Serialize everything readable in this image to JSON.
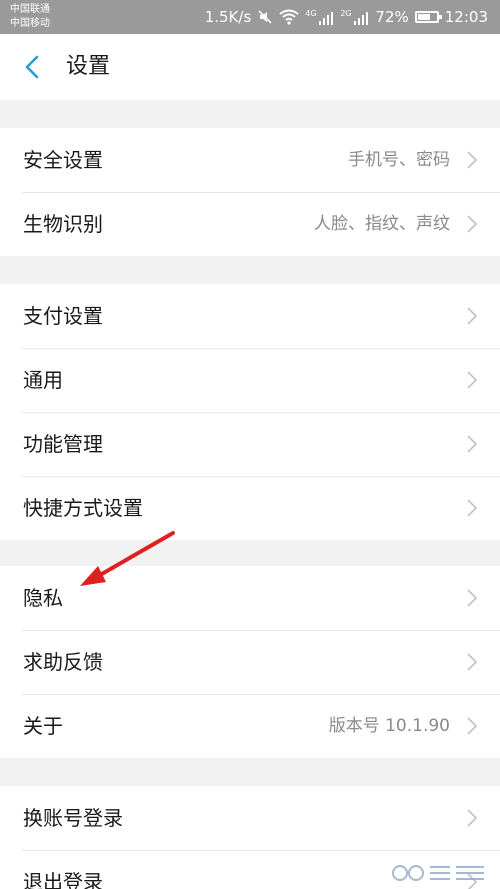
{
  "status_bar": {
    "carrier_1": "中国联通",
    "carrier_2": "中国移动",
    "net_speed": "1.5K/s",
    "signal_1_tag": "4G",
    "signal_2_tag": "2G",
    "battery": "72%",
    "battery_level": 0.72,
    "time": "12:03"
  },
  "header": {
    "title": "设置"
  },
  "groups": [
    {
      "rows": [
        {
          "label": "安全设置",
          "value": "手机号、密码"
        },
        {
          "label": "生物识别",
          "value": "人脸、指纹、声纹"
        }
      ]
    },
    {
      "rows": [
        {
          "label": "支付设置",
          "value": ""
        },
        {
          "label": "通用",
          "value": ""
        },
        {
          "label": "功能管理",
          "value": ""
        },
        {
          "label": "快捷方式设置",
          "value": ""
        }
      ]
    },
    {
      "rows": [
        {
          "label": "隐私",
          "value": ""
        },
        {
          "label": "求助反馈",
          "value": ""
        },
        {
          "label": "关于",
          "value": "版本号 10.1.90"
        }
      ]
    },
    {
      "rows": [
        {
          "label": "换账号登录",
          "value": ""
        },
        {
          "label": "退出登录",
          "value": ""
        }
      ]
    }
  ],
  "colors": {
    "accent": "#2a9bd6",
    "annotation": "#e02020",
    "status_bar": "#9a9a9a"
  },
  "icons": {
    "back": "chevron-left-icon",
    "row": "chevron-right-icon"
  }
}
